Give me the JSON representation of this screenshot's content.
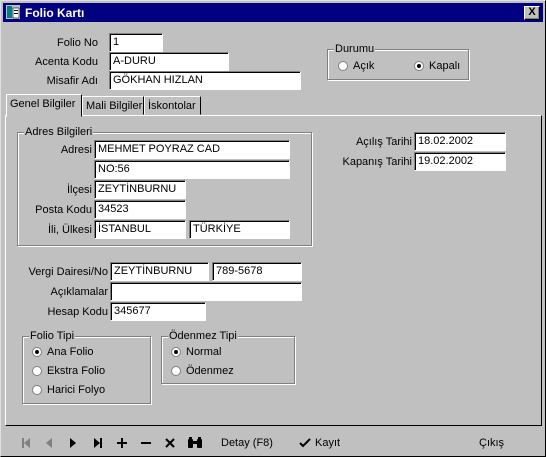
{
  "window": {
    "title": "Folio Kartı",
    "close_label": "X"
  },
  "header": {
    "folio_no": {
      "label": "Folio No",
      "value": "1"
    },
    "acenta_kodu": {
      "label": "Acenta Kodu",
      "value": "A-DURU"
    },
    "misafir_adi": {
      "label": "Misafir Adı",
      "value": "GÖKHAN HIZLAN"
    }
  },
  "durum": {
    "title": "Durumu",
    "options": [
      "Açık",
      "Kapalı"
    ],
    "selected": "Kapalı"
  },
  "tabs": [
    "Genel Bilgiler",
    "Mali Bilgiler",
    "İskontolar"
  ],
  "active_tab": "Genel Bilgiler",
  "adres": {
    "title": "Adres Bilgileri",
    "adres_label": "Adresi",
    "adres_line1": "MEHMET POYRAZ CAD",
    "adres_line2": "NO:56",
    "ilce_label": "İlçesi",
    "ilce": "ZEYTİNBURNU",
    "posta_label": "Posta Kodu",
    "posta": "34523",
    "il_label": "İli, Ülkesi",
    "il": "İSTANBUL",
    "ulke": "TÜRKİYE"
  },
  "tarih": {
    "acilis_label": "Açılış Tarihi",
    "acilis": "18.02.2002",
    "kapanis_label": "Kapanış Tarihi",
    "kapanis": "19.02.2002"
  },
  "vergi": {
    "label": "Vergi Dairesi/No",
    "dairesi": "ZEYTİNBURNU",
    "no": "789-5678",
    "aciklamalar_label": "Açıklamalar",
    "aciklamalar": "",
    "hesap_label": "Hesap Kodu",
    "hesap": "345677"
  },
  "folio_tipi": {
    "title": "Folio Tipi",
    "options": [
      "Ana Folio",
      "Ekstra Folio",
      "Harici Folyo"
    ],
    "selected": "Ana Folio"
  },
  "odenmez_tipi": {
    "title": "Ödenmez Tipi",
    "options": [
      "Normal",
      "Ödenmez"
    ],
    "selected": "Normal"
  },
  "toolbar": {
    "detay": "Detay (F8)",
    "kayit": "Kayıt",
    "cikis": "Çıkış"
  },
  "colors": {
    "title_bar": "#000080",
    "face": "#c0c0c0"
  }
}
